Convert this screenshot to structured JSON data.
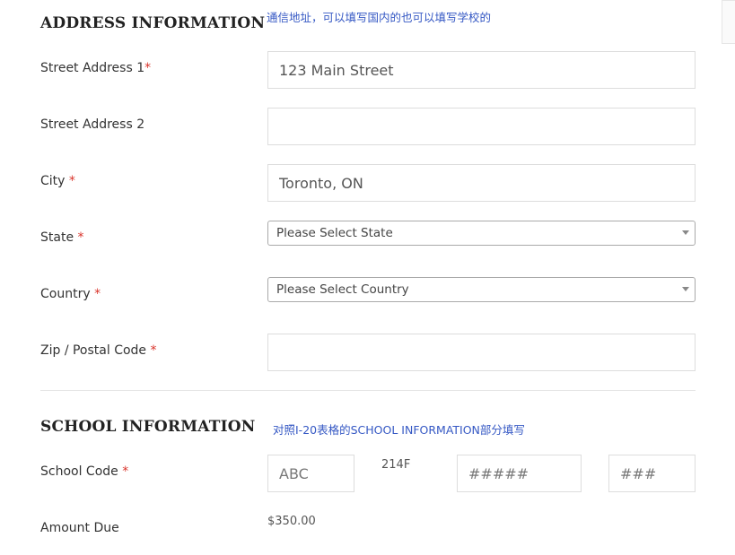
{
  "address": {
    "title": "ADDRESS INFORMATION",
    "hint": "通信地址，可以填写国内的也可以填写学校的",
    "street1": {
      "label": "Street Address 1",
      "required": "*",
      "value": "123 Main Street",
      "placeholder": ""
    },
    "street2": {
      "label": "Street Address 2",
      "required": "",
      "value": "",
      "placeholder": ""
    },
    "city": {
      "label": "City ",
      "required": "*",
      "value": "Toronto, ON",
      "placeholder": ""
    },
    "state": {
      "label": "State ",
      "required": "*",
      "selected": "Please Select State"
    },
    "country": {
      "label": "Country ",
      "required": "*",
      "selected": "Please Select Country"
    },
    "zip": {
      "label": "Zip / Postal Code ",
      "required": "*",
      "value": "",
      "placeholder": ""
    }
  },
  "school": {
    "title": "SCHOOL INFORMATION",
    "hint": "对照I-20表格的SCHOOL INFORMATION部分填写",
    "school_code": {
      "label": "School Code ",
      "required": "*",
      "prefix_placeholder": "ABC",
      "fixed_text": "214F",
      "middle_placeholder": "#####",
      "suffix_placeholder": "###"
    },
    "amount_due": {
      "label": "Amount Due",
      "value": "$350.00"
    }
  }
}
